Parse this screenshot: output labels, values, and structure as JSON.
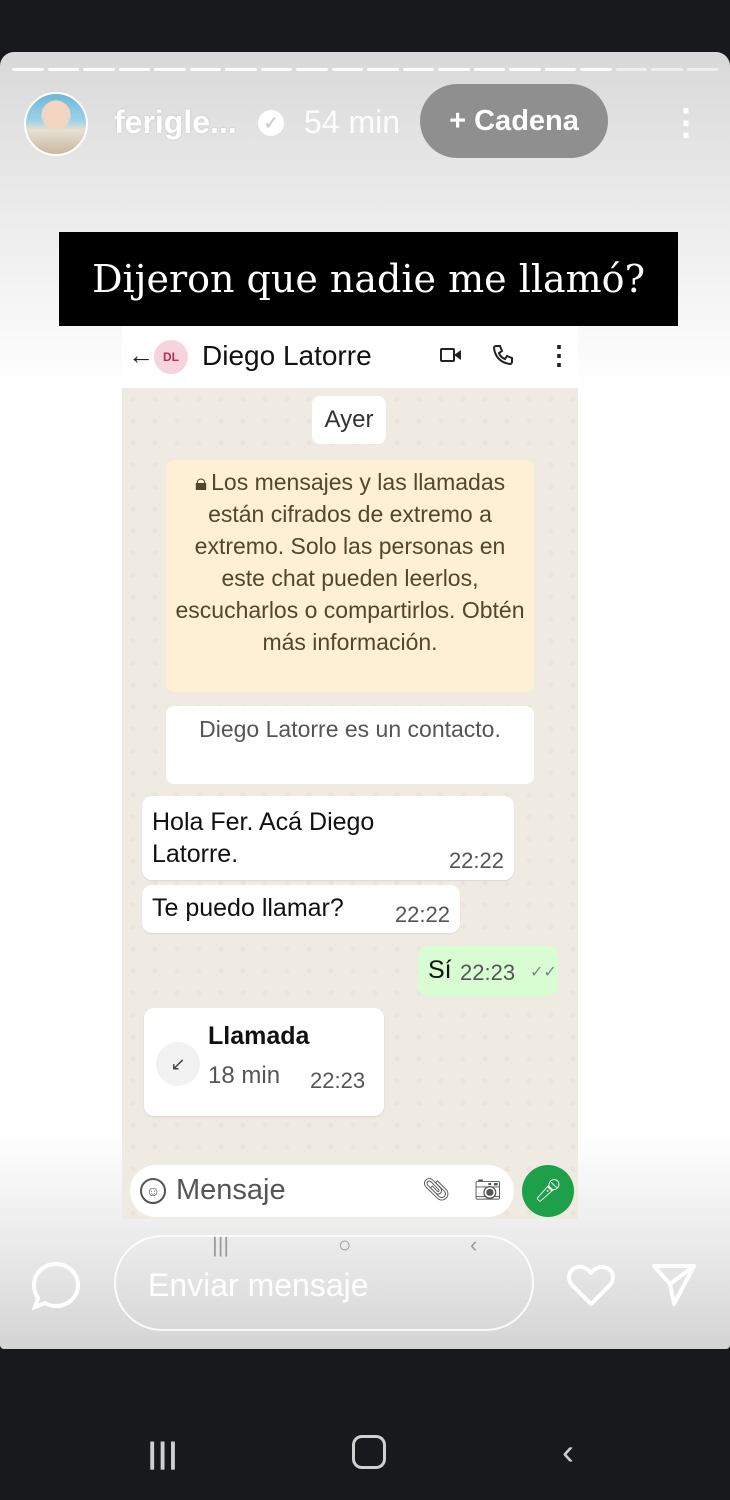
{
  "story": {
    "username": "ferigle...",
    "time_ago": "54 min",
    "chain_button": "+ Cadena",
    "banner_text": "Dijeron que nadie me llamó?"
  },
  "whatsapp": {
    "contact_initials": "DL",
    "contact_name": "Diego Latorre",
    "day_label": "Ayer",
    "encryption_notice": "Los mensajes y las llamadas están cifrados de extremo a extremo. Solo las personas en este chat pueden leerlos, escucharlos o compartirlos. Obtén más información.",
    "contact_note": "Diego Latorre es un contacto.",
    "messages": [
      {
        "direction": "in",
        "text": "Hola Fer. Acá Diego Latorre.",
        "time": "22:22"
      },
      {
        "direction": "in",
        "text": "Te puedo llamar?",
        "time": "22:22"
      },
      {
        "direction": "out",
        "text": "Sí",
        "time": "22:23"
      }
    ],
    "call": {
      "title": "Llamada",
      "duration": "18 min",
      "time": "22:23"
    },
    "input_placeholder": "Mensaje"
  },
  "footer": {
    "reply_placeholder": "Enviar mensaje"
  },
  "colors": {
    "whatsapp_green": "#1ea04a",
    "outgoing_bubble": "#d9fdd3",
    "notice_bg": "#fef0d5",
    "chat_bg": "#efeae2"
  }
}
